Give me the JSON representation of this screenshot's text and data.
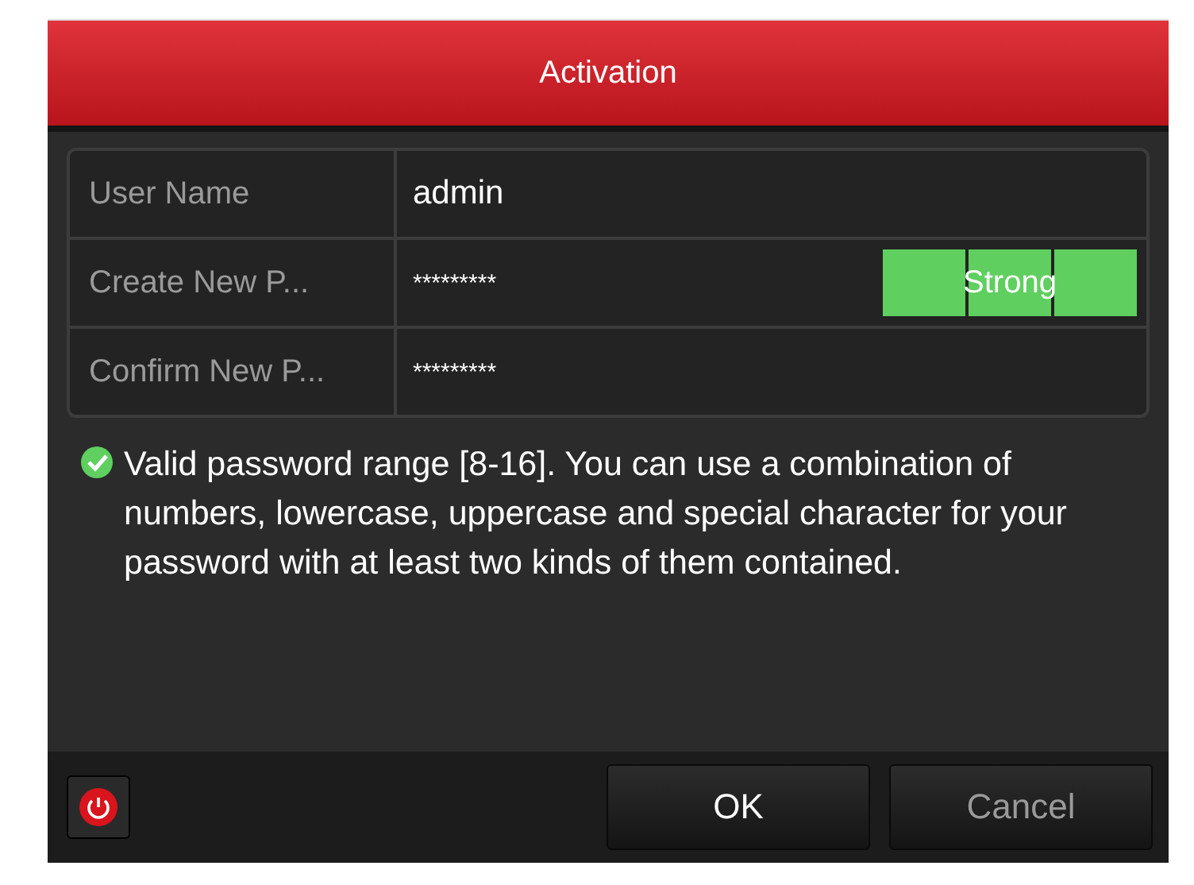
{
  "window": {
    "title": "Activation"
  },
  "fields": [
    {
      "label": "User Name",
      "value": "admin",
      "kind": "text"
    },
    {
      "label": "Create New P...",
      "value": "*********",
      "kind": "password",
      "strength": {
        "label": "Strong",
        "level": 1
      }
    },
    {
      "label": "Confirm New P...",
      "value": "*********",
      "kind": "password"
    }
  ],
  "hint": {
    "valid": true,
    "text": "Valid password range [8-16]. You can use a combination of numbers, lowercase, uppercase and special character for your password with at least two kinds of them contained."
  },
  "buttons": [
    {
      "label": "OK",
      "selected": true
    },
    {
      "label": "Cancel",
      "selected": false
    }
  ]
}
